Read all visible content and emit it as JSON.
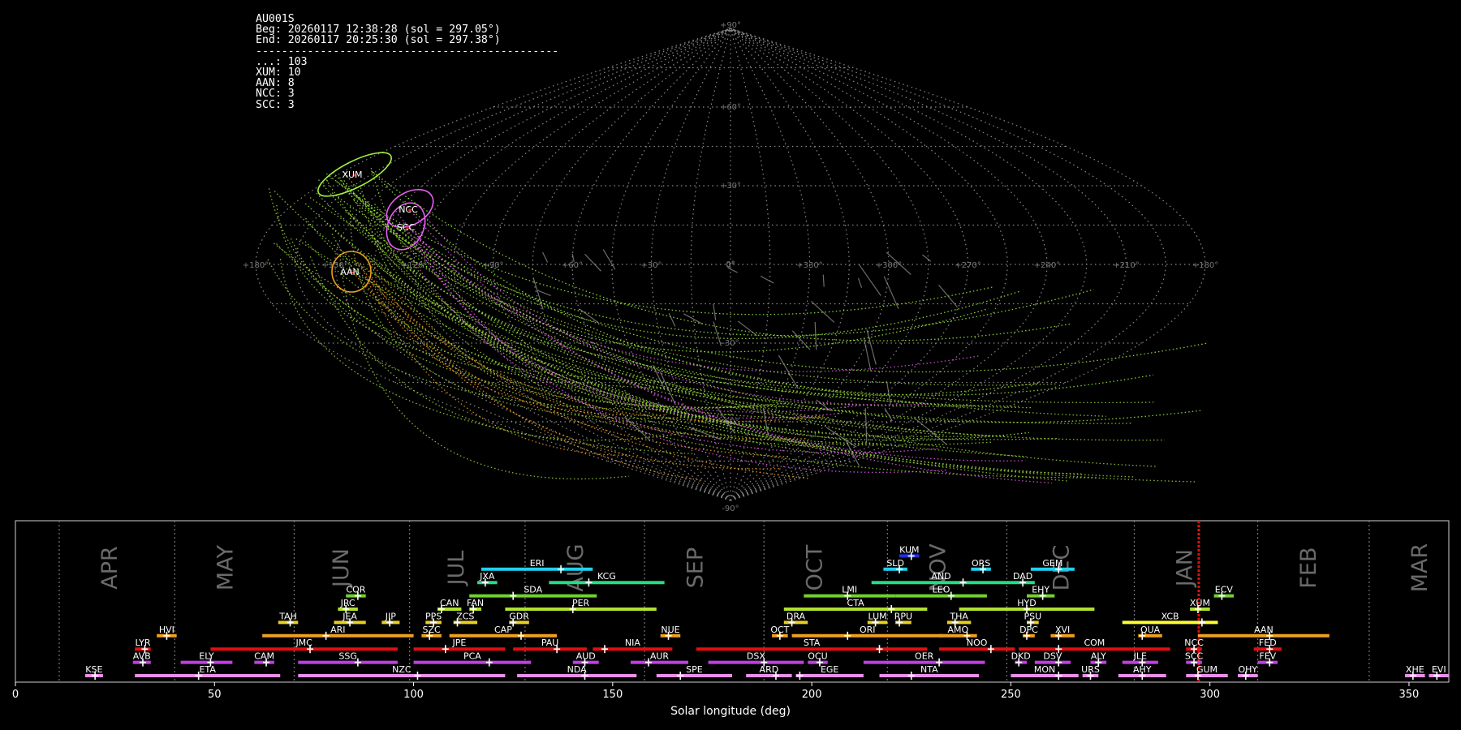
{
  "station": {
    "code": "AU001S",
    "begin": "Beg: 20260117 12:38:28 (sol = 297.05°)",
    "end": "End: 20260117 20:25:30 (sol = 297.38°)",
    "separator": "-----------------------------------------------",
    "counts": [
      "...: 103",
      "XUM: 10",
      "AAN: 8",
      "NCC: 3",
      "SCC: 3"
    ]
  },
  "sky_map": {
    "projection": "sinusoidal",
    "lat_labels": [
      "+90°",
      "+60°",
      "+30°",
      "0°",
      "-30°",
      "-60°",
      "-90°"
    ],
    "lon_labels": [
      "+180°",
      "+150°",
      "+120°",
      "+90°",
      "+60°",
      "+30°",
      "0°",
      "+330°",
      "+300°",
      "+270°",
      "+240°",
      "+210°",
      "+180°"
    ],
    "showers": [
      {
        "code": "XUM",
        "lon": 161,
        "lat": 32,
        "color": "#9ef03c"
      },
      {
        "code": "NCC",
        "lon": 128,
        "lat": 18,
        "color": "#e45ff0"
      },
      {
        "code": "SCC",
        "lon": 130,
        "lat": 10,
        "color": "#e45ff0"
      },
      {
        "code": "AAN",
        "lon": 145,
        "lat": 0,
        "color": "#f0a020"
      }
    ],
    "colors": {
      "grid": "#8a8a8a",
      "sporadic": "#9ad43a",
      "xum": "#9ef03c",
      "ncc": "#e45ff0",
      "aan": "#f0a020",
      "gray": "#9a9a9a"
    }
  },
  "timeline": {
    "xlabel": "Solar longitude (deg)",
    "xlim": [
      0,
      360
    ],
    "xticks": [
      0,
      50,
      100,
      150,
      200,
      250,
      300,
      350
    ],
    "current_sol": 297.2,
    "month_boundaries": [
      11,
      40,
      70,
      99,
      128,
      158,
      188,
      219,
      249,
      281,
      312,
      340
    ],
    "months": [
      {
        "label": "APR",
        "sol": 24
      },
      {
        "label": "MAY",
        "sol": 53
      },
      {
        "label": "JUN",
        "sol": 82
      },
      {
        "label": "JUL",
        "sol": 111
      },
      {
        "label": "AUG",
        "sol": 141
      },
      {
        "label": "SEP",
        "sol": 171
      },
      {
        "label": "OCT",
        "sol": 201
      },
      {
        "label": "NOV",
        "sol": 232
      },
      {
        "label": "DEC",
        "sol": 263
      },
      {
        "label": "JAN",
        "sol": 294
      },
      {
        "label": "FEB",
        "sol": 325
      },
      {
        "label": "MAR",
        "sol": 353
      }
    ]
  },
  "chart_data": {
    "type": "timeline",
    "title": "",
    "xlabel": "Solar longitude (deg)",
    "xlim": [
      0,
      360
    ],
    "current_sol": 297.2,
    "showers": [
      {
        "code": "KSE",
        "start": 17.5,
        "end": 22,
        "peak": 20,
        "row": 0,
        "color": "#e890e8"
      },
      {
        "code": "ETA",
        "start": 30,
        "end": 66.5,
        "peak": 46,
        "row": 0,
        "color": "#e890e8"
      },
      {
        "code": "NZC",
        "start": 71,
        "end": 123,
        "peak": 101,
        "row": 0,
        "color": "#e890e8"
      },
      {
        "code": "NDA",
        "start": 126,
        "end": 156,
        "peak": 143,
        "row": 0,
        "color": "#e890e8"
      },
      {
        "code": "SPE",
        "start": 161,
        "end": 180,
        "peak": 167,
        "row": 0,
        "color": "#e890e8"
      },
      {
        "code": "ARD",
        "start": 183.5,
        "end": 195,
        "peak": 191,
        "row": 0,
        "color": "#e890e8"
      },
      {
        "code": "EGE",
        "start": 196,
        "end": 213,
        "peak": 197,
        "row": 0,
        "color": "#e890e8"
      },
      {
        "code": "NTA",
        "start": 217,
        "end": 242,
        "peak": 225,
        "row": 0,
        "color": "#e890e8"
      },
      {
        "code": "MON",
        "start": 250,
        "end": 267,
        "peak": 262,
        "row": 0,
        "color": "#e890e8"
      },
      {
        "code": "URS",
        "start": 268,
        "end": 272,
        "peak": 270,
        "row": 0,
        "color": "#e890e8"
      },
      {
        "code": "AHY",
        "start": 277,
        "end": 289,
        "peak": 283,
        "row": 0,
        "color": "#e890e8"
      },
      {
        "code": "GUM",
        "start": 294,
        "end": 304.5,
        "peak": 297,
        "row": 0,
        "color": "#e890e8"
      },
      {
        "code": "OHY",
        "start": 307,
        "end": 312,
        "peak": 309,
        "row": 0,
        "color": "#e890e8"
      },
      {
        "code": "XHE",
        "start": 349,
        "end": 354,
        "peak": 351,
        "row": 0,
        "color": "#e890e8"
      },
      {
        "code": "EVI",
        "start": 355,
        "end": 360,
        "peak": 357,
        "row": 0,
        "color": "#e890e8"
      },
      {
        "code": "AVB",
        "start": 29.5,
        "end": 34,
        "peak": 32,
        "row": 1,
        "color": "#c040e0"
      },
      {
        "code": "ELY",
        "start": 41.5,
        "end": 54.5,
        "peak": 49,
        "row": 1,
        "color": "#c040e0"
      },
      {
        "code": "CAM",
        "start": 60,
        "end": 65,
        "peak": 63,
        "row": 1,
        "color": "#c040e0"
      },
      {
        "code": "SSG",
        "start": 71,
        "end": 96,
        "peak": 86,
        "row": 1,
        "color": "#c040e0"
      },
      {
        "code": "PCA",
        "start": 100,
        "end": 129.5,
        "peak": 119,
        "row": 1,
        "color": "#c040e0"
      },
      {
        "code": "AUD",
        "start": 140,
        "end": 146.5,
        "peak": 143,
        "row": 1,
        "color": "#c040e0"
      },
      {
        "code": "AUR",
        "start": 154.5,
        "end": 169,
        "peak": 159,
        "row": 1,
        "color": "#c040e0"
      },
      {
        "code": "DSX",
        "start": 174,
        "end": 198,
        "peak": 188,
        "row": 1,
        "color": "#c040e0"
      },
      {
        "code": "OCU",
        "start": 199,
        "end": 204,
        "peak": 202,
        "row": 1,
        "color": "#c040e0"
      },
      {
        "code": "OER",
        "start": 213,
        "end": 243.5,
        "peak": 232,
        "row": 1,
        "color": "#c040e0"
      },
      {
        "code": "DKD",
        "start": 251,
        "end": 254,
        "peak": 252,
        "row": 1,
        "color": "#c040e0"
      },
      {
        "code": "DSV",
        "start": 256,
        "end": 265,
        "peak": 262,
        "row": 1,
        "color": "#c040e0"
      },
      {
        "code": "ALY",
        "start": 270,
        "end": 274,
        "peak": 272,
        "row": 1,
        "color": "#c040e0"
      },
      {
        "code": "JLE",
        "start": 278,
        "end": 287,
        "peak": 283,
        "row": 1,
        "color": "#c040e0"
      },
      {
        "code": "SCC",
        "start": 294,
        "end": 298,
        "peak": 296,
        "row": 1,
        "color": "#c040e0"
      },
      {
        "code": "FEV",
        "start": 312,
        "end": 317,
        "peak": 315,
        "row": 1,
        "color": "#c040e0"
      },
      {
        "code": "LYR",
        "start": 30,
        "end": 34,
        "peak": 32.5,
        "row": 2,
        "color": "#e01010"
      },
      {
        "code": "JMC",
        "start": 49,
        "end": 96,
        "peak": 74,
        "row": 2,
        "color": "#e01010"
      },
      {
        "code": "JPE",
        "start": 100,
        "end": 123,
        "peak": 108,
        "row": 2,
        "color": "#e01010"
      },
      {
        "code": "PAU",
        "start": 125,
        "end": 143.5,
        "peak": 136,
        "row": 2,
        "color": "#e01010"
      },
      {
        "code": "NIA",
        "start": 145,
        "end": 165,
        "peak": 148,
        "row": 2,
        "color": "#e01010"
      },
      {
        "code": "STA",
        "start": 171,
        "end": 229,
        "peak": 217,
        "row": 2,
        "color": "#e01010"
      },
      {
        "code": "NOO",
        "start": 232,
        "end": 251,
        "peak": 245,
        "row": 2,
        "color": "#e01010"
      },
      {
        "code": "COM",
        "start": 252,
        "end": 290,
        "peak": 262,
        "row": 2,
        "color": "#e01010"
      },
      {
        "code": "NCC",
        "start": 294,
        "end": 298,
        "peak": 296,
        "row": 2,
        "color": "#e01010"
      },
      {
        "code": "FED",
        "start": 311,
        "end": 318,
        "peak": 315,
        "row": 2,
        "color": "#e01010"
      },
      {
        "code": "HVI",
        "start": 35.5,
        "end": 40.5,
        "peak": 38,
        "row": 3,
        "color": "#f0a020"
      },
      {
        "code": "ARI",
        "start": 62,
        "end": 100,
        "peak": 78,
        "row": 3,
        "color": "#f0a020"
      },
      {
        "code": "SZC",
        "start": 102,
        "end": 107,
        "peak": 104,
        "row": 3,
        "color": "#f0a020"
      },
      {
        "code": "CAP",
        "start": 109,
        "end": 136,
        "peak": 127,
        "row": 3,
        "color": "#f0a020"
      },
      {
        "code": "NUE",
        "start": 162,
        "end": 167,
        "peak": 164,
        "row": 3,
        "color": "#f0a020"
      },
      {
        "code": "OCT",
        "start": 190,
        "end": 194,
        "peak": 192,
        "row": 3,
        "color": "#f0a020"
      },
      {
        "code": "ORI",
        "start": 195,
        "end": 233,
        "peak": 209,
        "row": 3,
        "color": "#f0a020"
      },
      {
        "code": "AMO",
        "start": 232,
        "end": 241.5,
        "peak": 239,
        "row": 3,
        "color": "#f0a020"
      },
      {
        "code": "DPC",
        "start": 253,
        "end": 256,
        "peak": 254,
        "row": 3,
        "color": "#f0a020"
      },
      {
        "code": "XVI",
        "start": 260,
        "end": 266,
        "peak": 262,
        "row": 3,
        "color": "#f0a020"
      },
      {
        "code": "QUA",
        "start": 282,
        "end": 288,
        "peak": 283,
        "row": 3,
        "color": "#f0a020"
      },
      {
        "code": "AAN",
        "start": 297,
        "end": 330,
        "peak": 315,
        "row": 3,
        "color": "#f0a020"
      },
      {
        "code": "TAH",
        "start": 66,
        "end": 71,
        "peak": 69,
        "row": 4,
        "color": "#e8d020"
      },
      {
        "code": "JEA",
        "start": 80,
        "end": 88,
        "peak": 84,
        "row": 4,
        "color": "#e8d020"
      },
      {
        "code": "JIP",
        "start": 92,
        "end": 96.5,
        "peak": 94,
        "row": 4,
        "color": "#e8d020"
      },
      {
        "code": "PPS",
        "start": 103,
        "end": 107,
        "peak": 105,
        "row": 4,
        "color": "#e8d020"
      },
      {
        "code": "ZCS",
        "start": 110,
        "end": 116,
        "peak": 111,
        "row": 4,
        "color": "#e8d020"
      },
      {
        "code": "GDR",
        "start": 124,
        "end": 129,
        "peak": 125,
        "row": 4,
        "color": "#e8d020"
      },
      {
        "code": "DRA",
        "start": 193,
        "end": 199,
        "peak": 195,
        "row": 4,
        "color": "#e8d020"
      },
      {
        "code": "LUM",
        "start": 214,
        "end": 219,
        "peak": 216,
        "row": 4,
        "color": "#e8d020"
      },
      {
        "code": "RPU",
        "start": 221,
        "end": 225,
        "peak": 222,
        "row": 4,
        "color": "#e8d020"
      },
      {
        "code": "THA",
        "start": 234,
        "end": 240,
        "peak": 236,
        "row": 4,
        "color": "#e8d020"
      },
      {
        "code": "PSU",
        "start": 254,
        "end": 257,
        "peak": 255,
        "row": 4,
        "color": "#e8d020"
      },
      {
        "code": "XCB",
        "start": 278,
        "end": 302,
        "peak": 298,
        "row": 4,
        "color": "#ffff30"
      },
      {
        "code": "JRC",
        "start": 81,
        "end": 86,
        "peak": 83,
        "row": 5,
        "color": "#b0e030"
      },
      {
        "code": "CAN",
        "start": 106,
        "end": 112,
        "peak": 107,
        "row": 5,
        "color": "#b0e030"
      },
      {
        "code": "FAN",
        "start": 114,
        "end": 117,
        "peak": 115,
        "row": 5,
        "color": "#b0e030"
      },
      {
        "code": "PER",
        "start": 123,
        "end": 161,
        "peak": 140,
        "row": 5,
        "color": "#b0e030"
      },
      {
        "code": "CTA",
        "start": 193,
        "end": 229,
        "peak": 220,
        "row": 5,
        "color": "#b0e030"
      },
      {
        "code": "HYD",
        "start": 237,
        "end": 271,
        "peak": 254,
        "row": 5,
        "color": "#b0e030"
      },
      {
        "code": "XUM",
        "start": 295,
        "end": 300,
        "peak": 297,
        "row": 5,
        "color": "#b0e030"
      },
      {
        "code": "COR",
        "start": 83,
        "end": 88,
        "peak": 86,
        "row": 6,
        "color": "#70d030"
      },
      {
        "code": "SDA",
        "start": 114,
        "end": 146,
        "peak": 125,
        "row": 6,
        "color": "#70d030"
      },
      {
        "code": "LMI",
        "start": 198,
        "end": 221,
        "peak": 209,
        "row": 6,
        "color": "#70d030"
      },
      {
        "code": "LEO",
        "start": 221,
        "end": 244,
        "peak": 235,
        "row": 6,
        "color": "#70d030"
      },
      {
        "code": "EHY",
        "start": 254,
        "end": 261,
        "peak": 258,
        "row": 6,
        "color": "#70d030"
      },
      {
        "code": "ECV",
        "start": 301,
        "end": 306,
        "peak": 303,
        "row": 6,
        "color": "#70d030"
      },
      {
        "code": "JXA",
        "start": 116,
        "end": 121,
        "peak": 118,
        "row": 7,
        "color": "#20e080"
      },
      {
        "code": "KCG",
        "start": 134,
        "end": 163,
        "peak": 144,
        "row": 7,
        "color": "#20e080"
      },
      {
        "code": "AND",
        "start": 215,
        "end": 250,
        "peak": 238,
        "row": 7,
        "color": "#20e080"
      },
      {
        "code": "DAD",
        "start": 250,
        "end": 256,
        "peak": 253,
        "row": 7,
        "color": "#20e080"
      },
      {
        "code": "ERI",
        "start": 117,
        "end": 145,
        "peak": 137,
        "row": 8,
        "color": "#20d0f0"
      },
      {
        "code": "SLD",
        "start": 218,
        "end": 224,
        "peak": 222,
        "row": 8,
        "color": "#20d0f0"
      },
      {
        "code": "ORS",
        "start": 240,
        "end": 245,
        "peak": 243,
        "row": 8,
        "color": "#20d0f0"
      },
      {
        "code": "GEM",
        "start": 255,
        "end": 266,
        "peak": 262,
        "row": 8,
        "color": "#20d0f0"
      },
      {
        "code": "KUM",
        "start": 222,
        "end": 227,
        "peak": 225,
        "row": 9,
        "color": "#2030e0"
      }
    ]
  }
}
